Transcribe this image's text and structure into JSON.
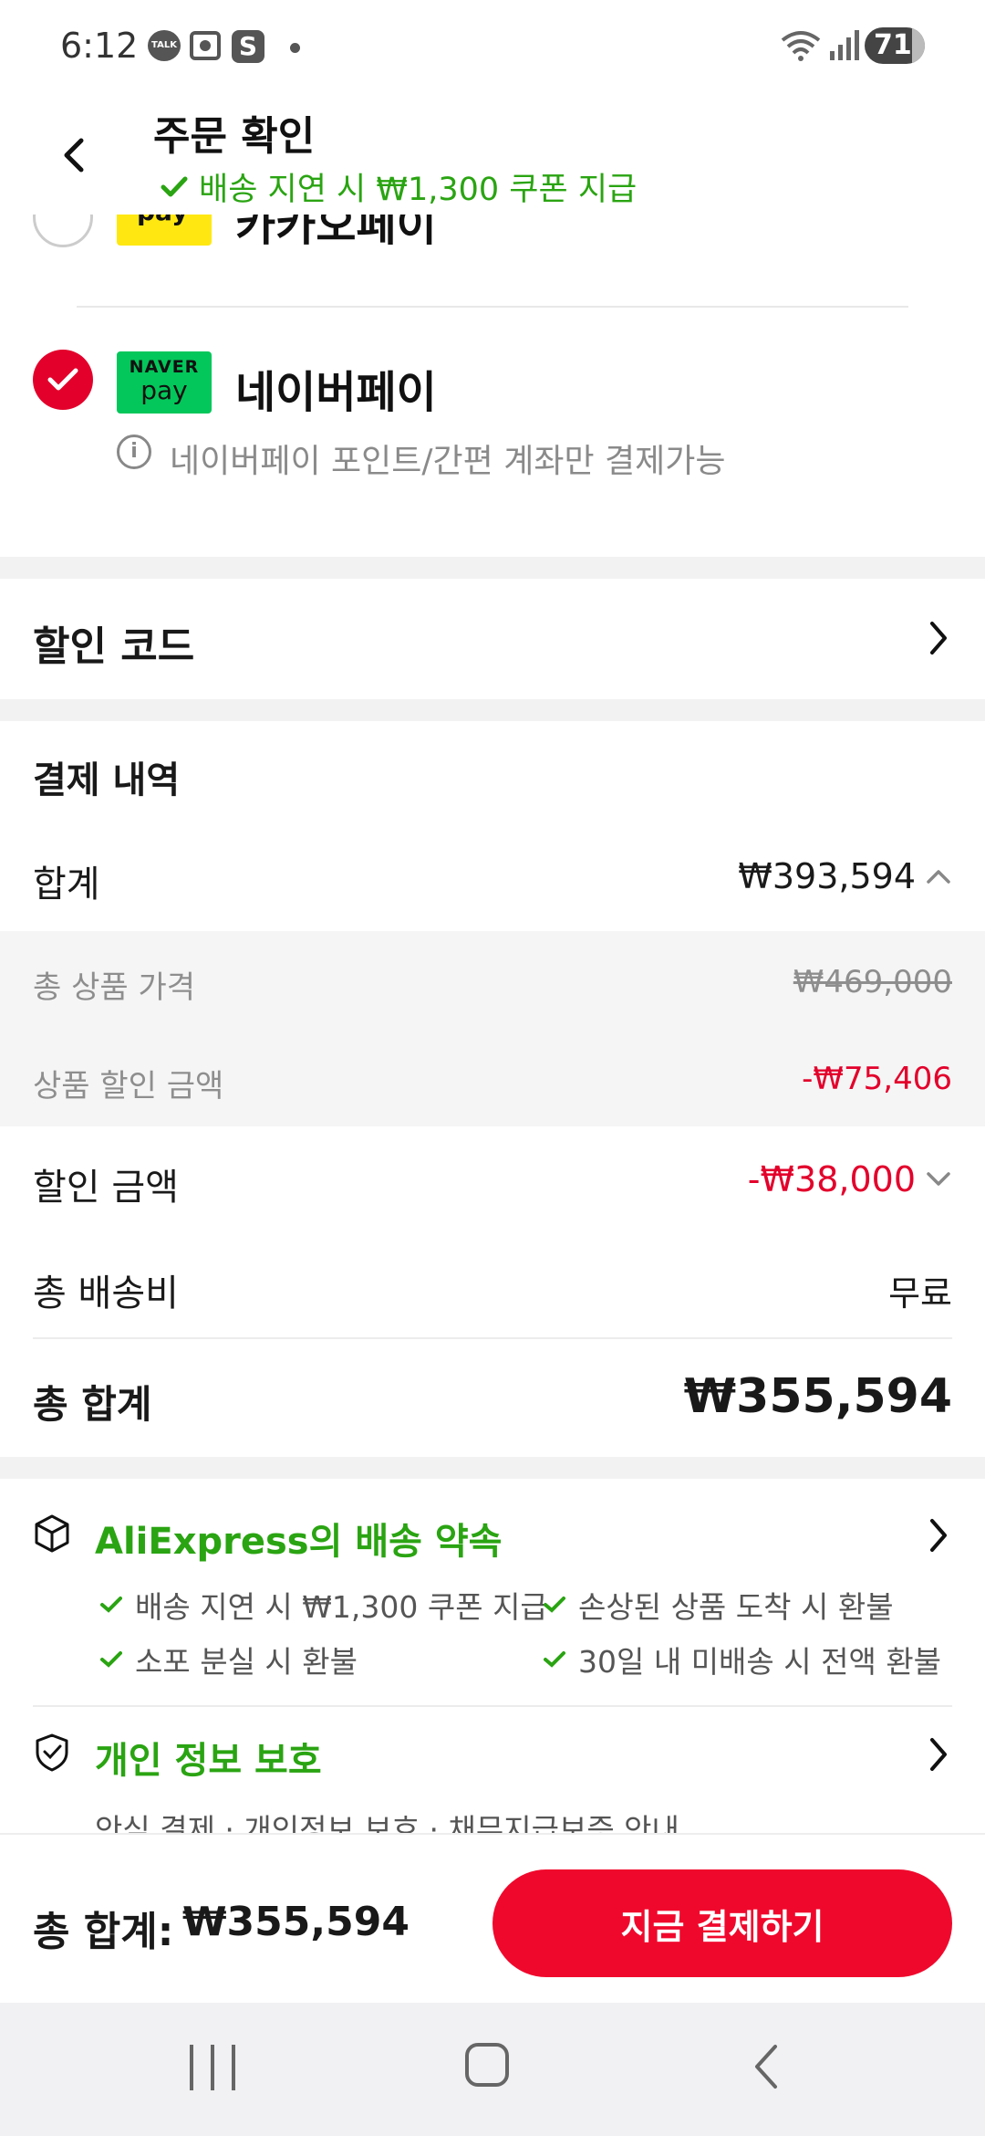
{
  "status_bar": {
    "time": "6:12",
    "talk_badge": "TALK",
    "s_badge": "S",
    "battery": "71"
  },
  "header": {
    "title": "주문 확인",
    "subtitle": "배송 지연 시 ₩1,300 쿠폰 지급"
  },
  "payment_methods": {
    "kakao": {
      "logo": "pay",
      "label": "카카오페이",
      "selected": false
    },
    "naver": {
      "logo_top": "NAVER",
      "logo_bottom": "pay",
      "label": "네이버페이",
      "selected": true,
      "note": "네이버페이 포인트/간편 계좌만 결제가능"
    }
  },
  "discount_code": {
    "label": "할인 코드"
  },
  "summary": {
    "title": "결제 내역",
    "subtotal_label": "합계",
    "subtotal_value": "₩393,594",
    "product_total_label": "총 상품 가격",
    "product_total_value": "₩469,000",
    "product_discount_label": "상품 할인 금액",
    "product_discount_value": "-₩75,406",
    "discount_label": "할인 금액",
    "discount_value": "-₩38,000",
    "shipping_label": "총 배송비",
    "shipping_value": "무료",
    "total_label": "총 합계",
    "total_value": "₩355,594"
  },
  "promise": {
    "title": "AliExpress의 배송 약속",
    "items": [
      "배송 지연 시 ₩1,300 쿠폰 지급",
      "손상된 상품 도착 시 환불",
      "소포 분실 시 환불",
      "30일 내 미배송 시 전액 환불"
    ]
  },
  "privacy": {
    "title": "개인 정보 보호",
    "subtitle": "안심 결제 · 개인정보 보호 · 채무지급보증 안내"
  },
  "bottom_bar": {
    "total_label": "총 합계:",
    "total_value": "₩355,594",
    "pay_button": "지금 결제하기"
  },
  "colors": {
    "accent_red": "#f0082c",
    "discount_red": "#e3002b",
    "green": "#2aa412",
    "naver_green": "#03c75a",
    "kakao_yellow": "#ffe812"
  }
}
